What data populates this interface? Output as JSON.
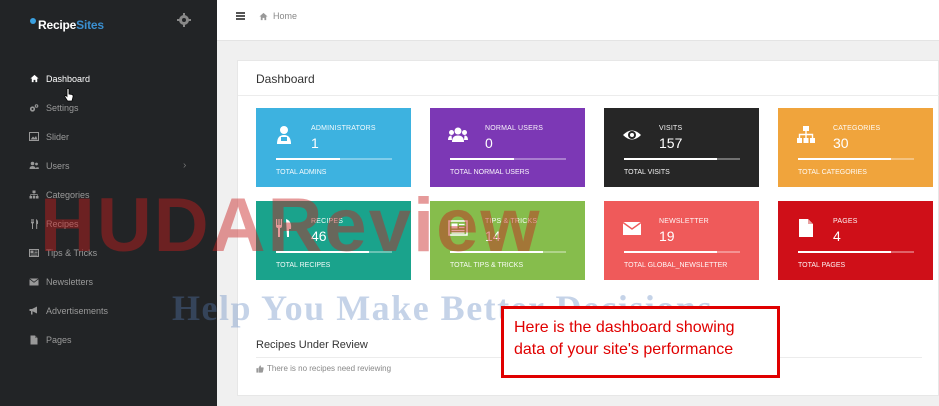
{
  "brand": {
    "part1": "Recipe",
    "part2": "Sites"
  },
  "sidebar": {
    "items": [
      {
        "label": "Dashboard",
        "icon": "home-icon",
        "active": true
      },
      {
        "label": "Settings",
        "icon": "gears-icon"
      },
      {
        "label": "Slider",
        "icon": "image-icon"
      },
      {
        "label": "Users",
        "icon": "users-icon",
        "has_submenu": true
      },
      {
        "label": "Categories",
        "icon": "sitemap-icon"
      },
      {
        "label": "Recipes",
        "icon": "cutlery-icon"
      },
      {
        "label": "Tips & Tricks",
        "icon": "newspaper-icon"
      },
      {
        "label": "Newsletters",
        "icon": "envelope-icon"
      },
      {
        "label": "Advertisements",
        "icon": "bullhorn-icon"
      },
      {
        "label": "Pages",
        "icon": "file-icon"
      }
    ]
  },
  "topbar": {
    "breadcrumb": "Home"
  },
  "dashboard": {
    "title": "Dashboard",
    "cards": [
      {
        "title": "ADMINISTRATORS",
        "value": "1",
        "footer": "TOTAL ADMINS",
        "color": "#3db2e0",
        "icon": "admin-icon",
        "progress": 0.55
      },
      {
        "title": "NORMAL USERS",
        "value": "0",
        "footer": "TOTAL NORMAL USERS",
        "color": "#7c38b5",
        "icon": "users-icon",
        "progress": 0.55
      },
      {
        "title": "VISITS",
        "value": "157",
        "footer": "TOTAL VISITS",
        "color": "#262626",
        "icon": "eye-icon",
        "progress": 0.8
      },
      {
        "title": "CATEGORIES",
        "value": "30",
        "footer": "TOTAL CATEGORIES",
        "color": "#f0a43c",
        "icon": "sitemap-icon",
        "progress": 0.8
      },
      {
        "title": "RECIPES",
        "value": "46",
        "footer": "TOTAL RECIPES",
        "color": "#1aa38c",
        "icon": "cutlery-icon",
        "progress": 0.8
      },
      {
        "title": "TIPS & TRICKS",
        "value": "14",
        "footer": "TOTAL TIPS & TRICKS",
        "color": "#86bd4c",
        "icon": "newspaper-icon",
        "progress": 0.8
      },
      {
        "title": "NEWSLETTER",
        "value": "19",
        "footer": "TOTAL GLOBAL_NEWSLETTER",
        "color": "#ef5a5a",
        "icon": "envelope-icon",
        "progress": 0.8
      },
      {
        "title": "PAGES",
        "value": "4",
        "footer": "TOTAL PAGES",
        "color": "#cf0f18",
        "icon": "file-icon",
        "progress": 0.8
      }
    ],
    "review_title": "Recipes Under Review",
    "review_empty": "There is no recipes need reviewing"
  },
  "watermark": {
    "main": "HUDAReview",
    "sub": "Help You Make Better Decisions"
  },
  "callout": {
    "line1": "Here is the dashboard showing",
    "line2": "data of your site's performance"
  }
}
